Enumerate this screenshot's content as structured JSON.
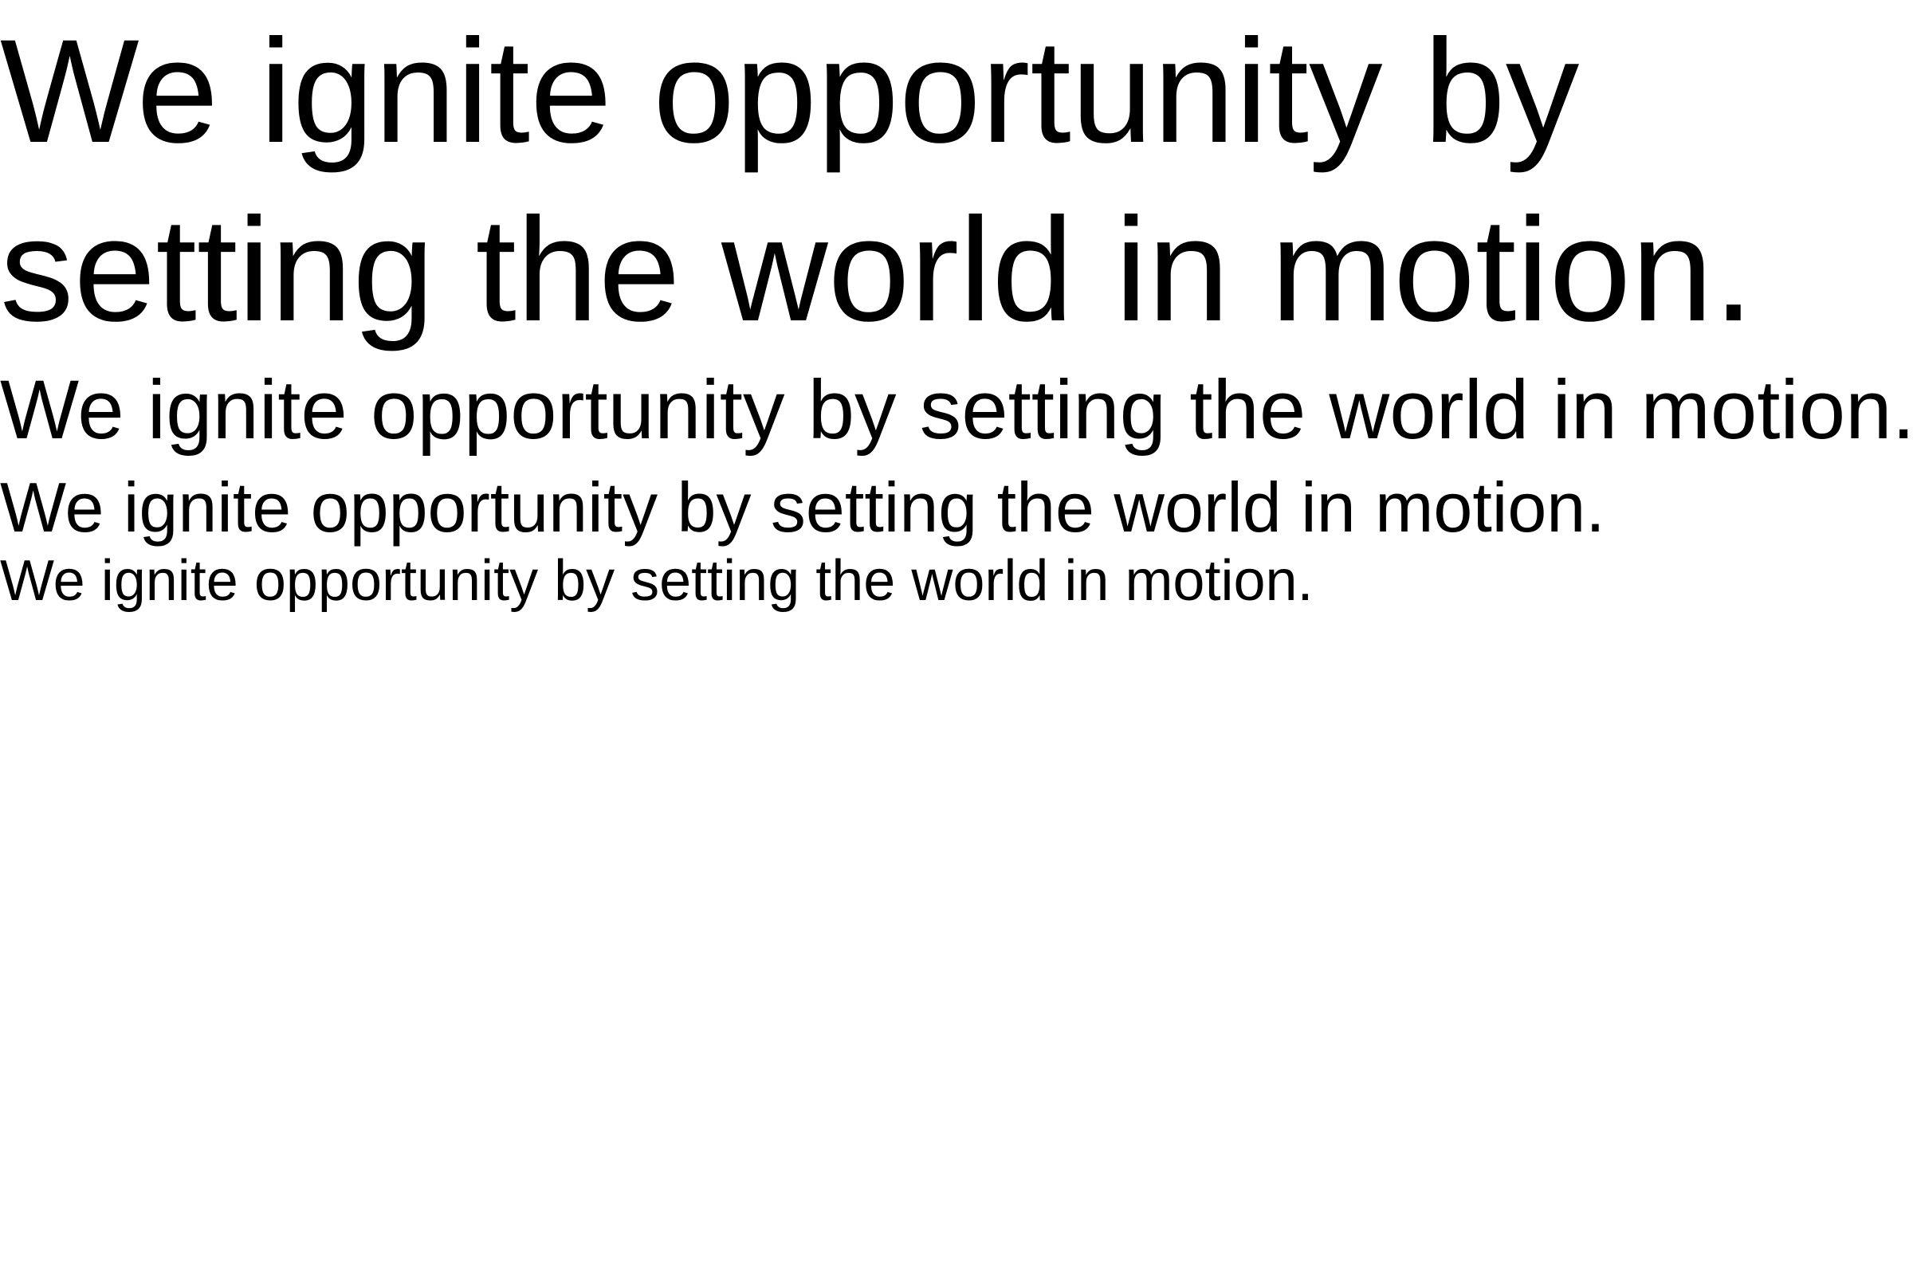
{
  "type_specimen": {
    "display_line_1": "We ignite opportunity by",
    "display_line_2": "setting the world in motion.",
    "heading_line": "We ignite opportunity by setting the world in motion.",
    "subheading_line": "We ignite opportunity by setting the world in motion.",
    "body_line": "We ignite opportunity by setting the world in motion."
  },
  "colors": {
    "text": "#000000",
    "background": "#ffffff"
  }
}
